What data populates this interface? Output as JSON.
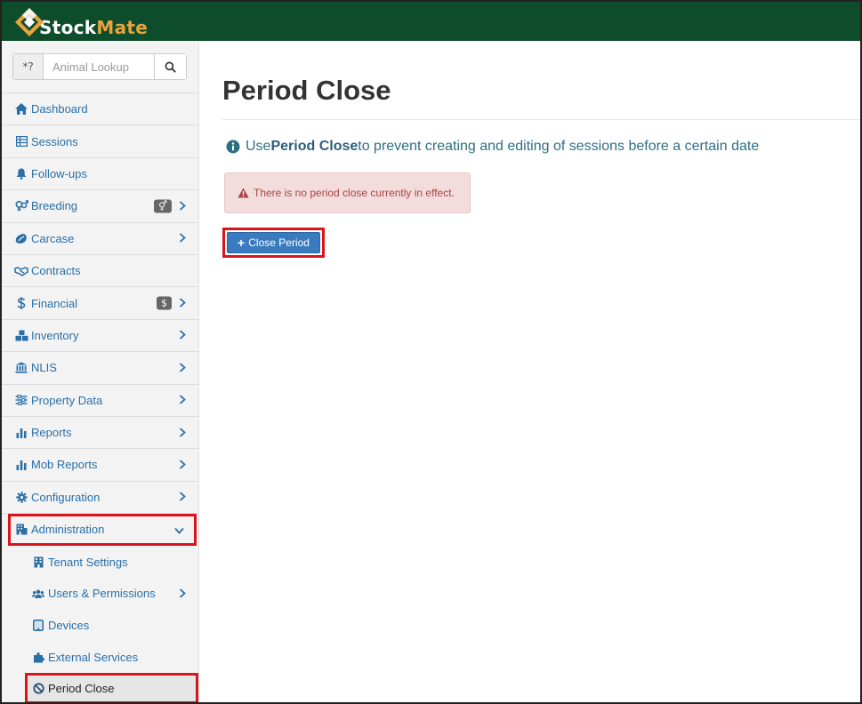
{
  "brand": {
    "name_part1": "Stock",
    "name_part2": "Mate",
    "header_color": "#0e4d2b",
    "accent": "#e8a33c"
  },
  "lookup": {
    "wildcard_label": "*?",
    "placeholder": "Animal Lookup"
  },
  "nav": {
    "items": [
      {
        "label": "Dashboard",
        "icon": "home-icon"
      },
      {
        "label": "Sessions",
        "icon": "table-icon"
      },
      {
        "label": "Follow-ups",
        "icon": "bell-icon"
      },
      {
        "label": "Breeding",
        "icon": "breeding-icon",
        "badge": "⚥"
      },
      {
        "label": "Carcase",
        "icon": "carcase-icon"
      },
      {
        "label": "Contracts",
        "icon": "handshake-icon"
      },
      {
        "label": "Financial",
        "icon": "dollar-icon",
        "badge": "$"
      },
      {
        "label": "Inventory",
        "icon": "boxes-icon"
      },
      {
        "label": "NLIS",
        "icon": "bank-icon"
      },
      {
        "label": "Property Data",
        "icon": "sliders-icon"
      },
      {
        "label": "Reports",
        "icon": "bar-chart-icon"
      },
      {
        "label": "Mob Reports",
        "icon": "bar-chart-icon"
      },
      {
        "label": "Configuration",
        "icon": "gear-icon"
      },
      {
        "label": "Administration",
        "icon": "building-icon"
      }
    ],
    "admin_sub": [
      {
        "label": "Tenant Settings",
        "icon": "building-icon"
      },
      {
        "label": "Users & Permissions",
        "icon": "users-icon"
      },
      {
        "label": "Devices",
        "icon": "tablet-icon"
      },
      {
        "label": "External Services",
        "icon": "puzzle-icon"
      },
      {
        "label": "Period Close",
        "icon": "ban-icon"
      }
    ]
  },
  "main": {
    "title": "Period Close",
    "info_prefix": "Use ",
    "info_bold": "Period Close",
    "info_suffix": " to prevent creating and editing of sessions before a certain date",
    "alert_text": "There is no period close currently in effect.",
    "button_label": "Close Period"
  }
}
